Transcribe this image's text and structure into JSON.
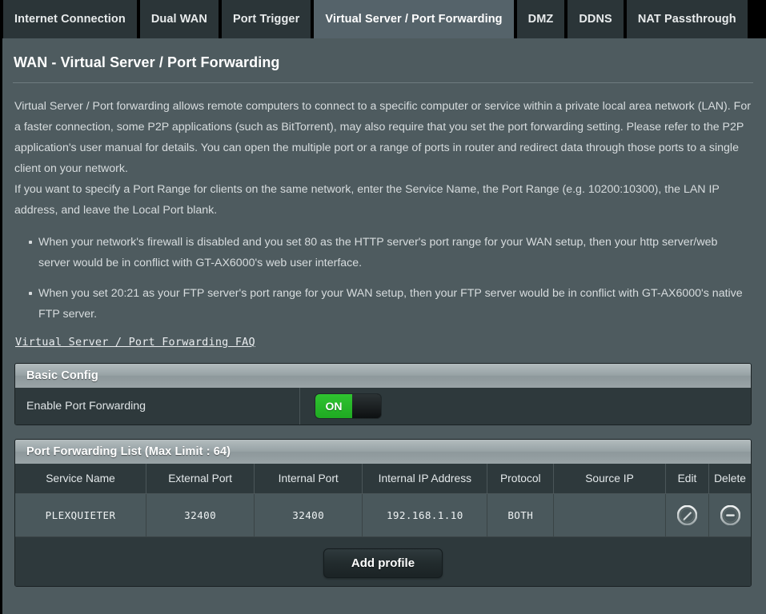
{
  "tabs": [
    {
      "label": "Internet Connection",
      "active": false
    },
    {
      "label": "Dual WAN",
      "active": false
    },
    {
      "label": "Port Trigger",
      "active": false
    },
    {
      "label": "Virtual Server / Port Forwarding",
      "active": true
    },
    {
      "label": "DMZ",
      "active": false
    },
    {
      "label": "DDNS",
      "active": false
    },
    {
      "label": "NAT Passthrough",
      "active": false
    }
  ],
  "page": {
    "title": "WAN - Virtual Server / Port Forwarding",
    "description": [
      "Virtual Server / Port forwarding allows remote computers to connect to a specific computer or service within a private local area network (LAN). For a faster connection, some P2P applications (such as BitTorrent), may also require that you set the port forwarding setting. Please refer to the P2P application's user manual for details. You can open the multiple port or a range of ports in router and redirect data through those ports to a single client on your network.",
      "If you want to specify a Port Range for clients on the same network, enter the Service Name, the Port Range (e.g. 10200:10300), the LAN IP address, and leave the Local Port blank."
    ],
    "notes": [
      "When your network's firewall is disabled and you set 80 as the HTTP server's port range for your WAN setup, then your http server/web server would be in conflict with GT-AX6000's web user interface.",
      "When you set 20:21 as your FTP server's port range for your WAN setup, then your FTP server would be in conflict with GT-AX6000's native FTP server."
    ],
    "faq_link": "Virtual Server / Port Forwarding FAQ"
  },
  "basic_config": {
    "heading": "Basic Config",
    "enable_label": "Enable Port Forwarding",
    "toggle_state": "ON"
  },
  "forwarding_list": {
    "heading": "Port Forwarding List (Max Limit : 64)",
    "columns": [
      "Service Name",
      "External Port",
      "Internal Port",
      "Internal IP Address",
      "Protocol",
      "Source IP",
      "Edit",
      "Delete"
    ],
    "rows": [
      {
        "service_name": "PLEXQUIETER",
        "external_port": "32400",
        "internal_port": "32400",
        "internal_ip": "192.168.1.10",
        "protocol": "BOTH",
        "source_ip": ""
      }
    ],
    "add_button": "Add profile"
  },
  "colors": {
    "page_bg": "#4e5b5f",
    "tab_inactive": "#2b3538",
    "tab_active": "#55636a",
    "panel_body": "#2e393c",
    "row_bg": "#4a585c",
    "toggle_green": "#22b024"
  }
}
